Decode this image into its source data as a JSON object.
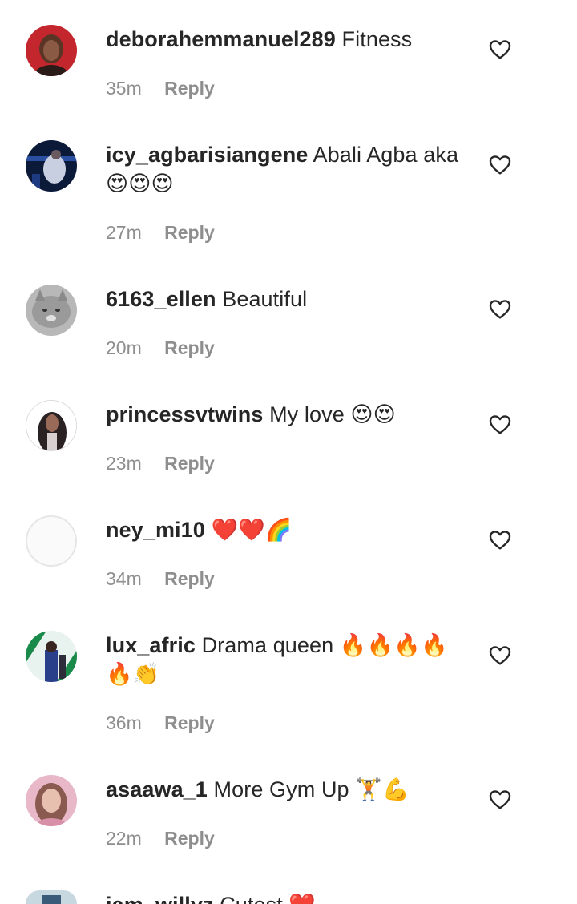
{
  "comments": [
    {
      "username": "deborahemmanuel289",
      "text": "Fitness",
      "time": "35m",
      "reply_label": "Reply",
      "avatar_icon": "avatar-photo-woman-red-background"
    },
    {
      "username": "icy_agbarisiangene",
      "text": "Abali Agba aka 😍😍😍",
      "time": "27m",
      "reply_label": "Reply",
      "avatar_icon": "avatar-photo-dark-blue"
    },
    {
      "username": "6163_ellen",
      "text": "Beautiful",
      "time": "20m",
      "reply_label": "Reply",
      "avatar_icon": "avatar-photo-grey-cat"
    },
    {
      "username": "princessvtwins",
      "text": "My love 😍😍",
      "time": "23m",
      "reply_label": "Reply",
      "avatar_icon": "avatar-photo-woman-long-hair"
    },
    {
      "username": "ney_mi10",
      "text": "❤️❤️🌈",
      "time": "34m",
      "reply_label": "Reply",
      "avatar_icon": "avatar-blank"
    },
    {
      "username": "lux_afric",
      "text": "Drama queen 🔥🔥🔥🔥🔥👏",
      "time": "36m",
      "reply_label": "Reply",
      "avatar_icon": "avatar-photo-nigeria-flag"
    },
    {
      "username": "asaawa_1",
      "text": "More Gym Up 🏋️💪",
      "time": "22m",
      "reply_label": "Reply",
      "avatar_icon": "avatar-photo-woman-pink"
    },
    {
      "username": "iam_willyz",
      "text": "Cutest ❤️",
      "time": "",
      "reply_label": "",
      "avatar_icon": "avatar-photo-partial"
    }
  ],
  "icons": {
    "like": "heart-outline-icon"
  },
  "colors": {
    "text": "#262626",
    "secondary": "#8e8e8e",
    "background": "#ffffff"
  }
}
